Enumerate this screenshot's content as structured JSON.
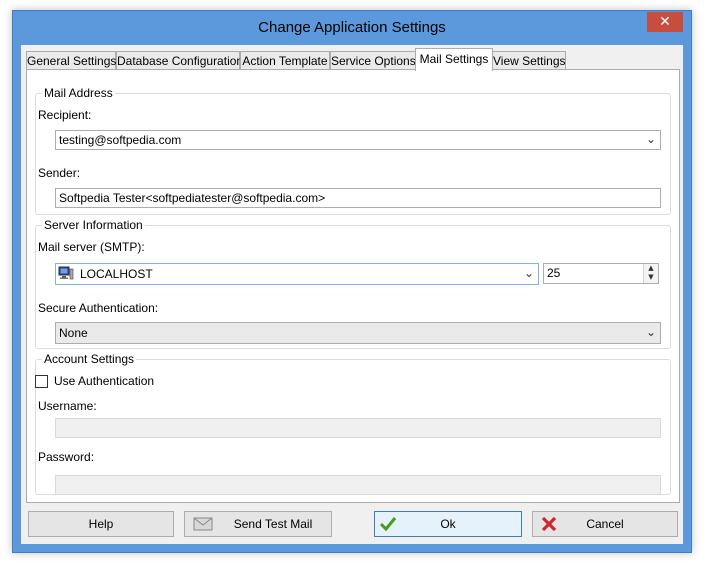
{
  "window": {
    "title": "Change Application Settings",
    "close_glyph": "✕"
  },
  "tabs": [
    {
      "label": "General Settings",
      "active": false
    },
    {
      "label": "Database Configuration",
      "active": false
    },
    {
      "label": "Action Template",
      "active": false
    },
    {
      "label": "Service Options",
      "active": false
    },
    {
      "label": "Mail Settings",
      "active": true
    },
    {
      "label": "View Settings",
      "active": false
    }
  ],
  "mail_address": {
    "legend": "Mail Address",
    "recipient_label": "Recipient:",
    "recipient_value": "testing@softpedia.com",
    "sender_label": "Sender:",
    "sender_value": "Softpedia Tester<softpediatester@softpedia.com>"
  },
  "server_info": {
    "legend": "Server Information",
    "smtp_label": "Mail server (SMTP):",
    "smtp_value": "LOCALHOST",
    "port_value": "25",
    "secure_label": "Secure Authentication:",
    "secure_value": "None"
  },
  "account": {
    "legend": "Account Settings",
    "use_auth_label": "Use Authentication",
    "use_auth_checked": false,
    "username_label": "Username:",
    "username_value": "",
    "password_label": "Password:",
    "password_value": ""
  },
  "buttons": {
    "help": "Help",
    "send_test": "Send Test Mail",
    "ok": "Ok",
    "cancel": "Cancel"
  },
  "icons": {
    "dropdown_arrow": "⌄",
    "spin_up": "▲",
    "spin_down": "▼"
  },
  "colors": {
    "title_bar": "#5b99dc",
    "close_button": "#c74d3f",
    "ok_check": "#4a9a1e",
    "cancel_x": "#d4252b"
  }
}
